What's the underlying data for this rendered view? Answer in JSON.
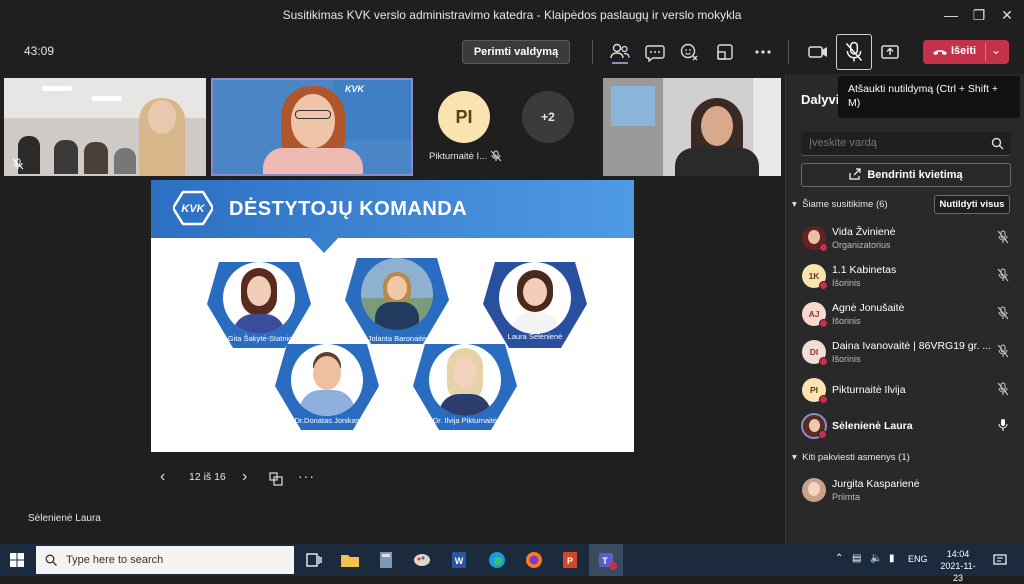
{
  "window": {
    "title": "Susitikimas KVK verslo administravimo katedra - Klaipėdos paslaugų ir verslo mokykla"
  },
  "toolbar": {
    "timer": "43:09",
    "take_control": "Perimti valdymą",
    "leave": "Išeiti"
  },
  "tooltip": {
    "text": "Atšaukti nutildymą (Ctrl + Shift + M)"
  },
  "video_tiles": {
    "participant_initials": "PI",
    "participant_name": "Pikturnaitė I...",
    "overflow": "+2",
    "kvk_caption": "KVK"
  },
  "slide": {
    "title": "DĖSTYTOJŲ KOMANDA",
    "logo": "KVK",
    "people": [
      "Dr.Gita Šakytė-Statnickė",
      "Jolanta Baronaitė",
      "Laura Sėlenienė",
      "Dr.Donatas Jonikas",
      "Dr. Ilvija Pikturnaitė"
    ],
    "page_indicator": "12 iš 16"
  },
  "speaker": {
    "name": "Sėlenienė Laura"
  },
  "panel": {
    "title": "Dalyviai",
    "search_placeholder": "Įveskite vardą",
    "share_button": "Bendrinti kvietimą",
    "in_meeting_label": "Šiame susitikime (6)",
    "mute_all": "Nutildyti visus",
    "others_label": "Kiti pakviesti asmenys (1)",
    "participants": [
      {
        "initials": "",
        "name": "Vida Žvinienė",
        "role": "Organizatorius"
      },
      {
        "initials": "1K",
        "name": "1.1 Kabinetas",
        "role": "Išorinis"
      },
      {
        "initials": "AJ",
        "name": "Agnė Jonušaitė",
        "role": "Išorinis"
      },
      {
        "initials": "DI",
        "name": "Daina Ivanovaitė | 86VRG19 gr. ...",
        "role": "Išorinis"
      },
      {
        "initials": "PI",
        "name": "Pikturnaitė Ilvija",
        "role": ""
      },
      {
        "initials": "",
        "name": "Sėlenienė Laura",
        "role": ""
      }
    ],
    "others": [
      {
        "initials": "",
        "name": "Jurgita Kasparienė",
        "role": "Priimta"
      }
    ]
  },
  "taskbar": {
    "search_placeholder": "Type here to search",
    "language": "ENG",
    "time": "14:04",
    "date": "2021-11-23"
  },
  "colors": {
    "accent_red": "#c4314b",
    "teams_purple": "#8b8cc7",
    "slide_blue": "#2d6fc2"
  }
}
